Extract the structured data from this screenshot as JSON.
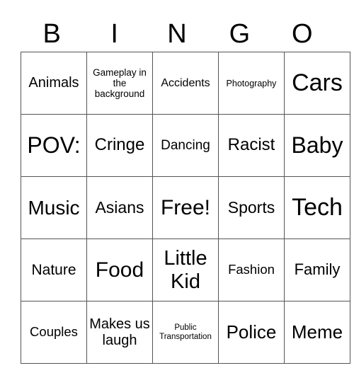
{
  "header": [
    "B",
    "I",
    "N",
    "G",
    "O"
  ],
  "rows": [
    [
      {
        "text": "Animals",
        "size": 20
      },
      {
        "text": "Gameplay in the background",
        "size": 13.5
      },
      {
        "text": "Accidents",
        "size": 16
      },
      {
        "text": "Photography",
        "size": 12.5
      },
      {
        "text": "Cars",
        "size": 34
      }
    ],
    [
      {
        "text": "POV:",
        "size": 32
      },
      {
        "text": "Cringe",
        "size": 24
      },
      {
        "text": "Dancing",
        "size": 19
      },
      {
        "text": "Racist",
        "size": 24
      },
      {
        "text": "Baby",
        "size": 32
      }
    ],
    [
      {
        "text": "Music",
        "size": 28
      },
      {
        "text": "Asians",
        "size": 23
      },
      {
        "text": "Free!",
        "size": 30
      },
      {
        "text": "Sports",
        "size": 23
      },
      {
        "text": "Tech",
        "size": 34
      }
    ],
    [
      {
        "text": "Nature",
        "size": 21
      },
      {
        "text": "Food",
        "size": 30
      },
      {
        "text": "Little Kid",
        "size": 29
      },
      {
        "text": "Fashion",
        "size": 18.5
      },
      {
        "text": "Family",
        "size": 22
      }
    ],
    [
      {
        "text": "Couples",
        "size": 18.5
      },
      {
        "text": "Makes us laugh",
        "size": 20
      },
      {
        "text": "Public Transportation",
        "size": 11.5
      },
      {
        "text": "Police",
        "size": 26
      },
      {
        "text": "Meme",
        "size": 26
      }
    ]
  ]
}
